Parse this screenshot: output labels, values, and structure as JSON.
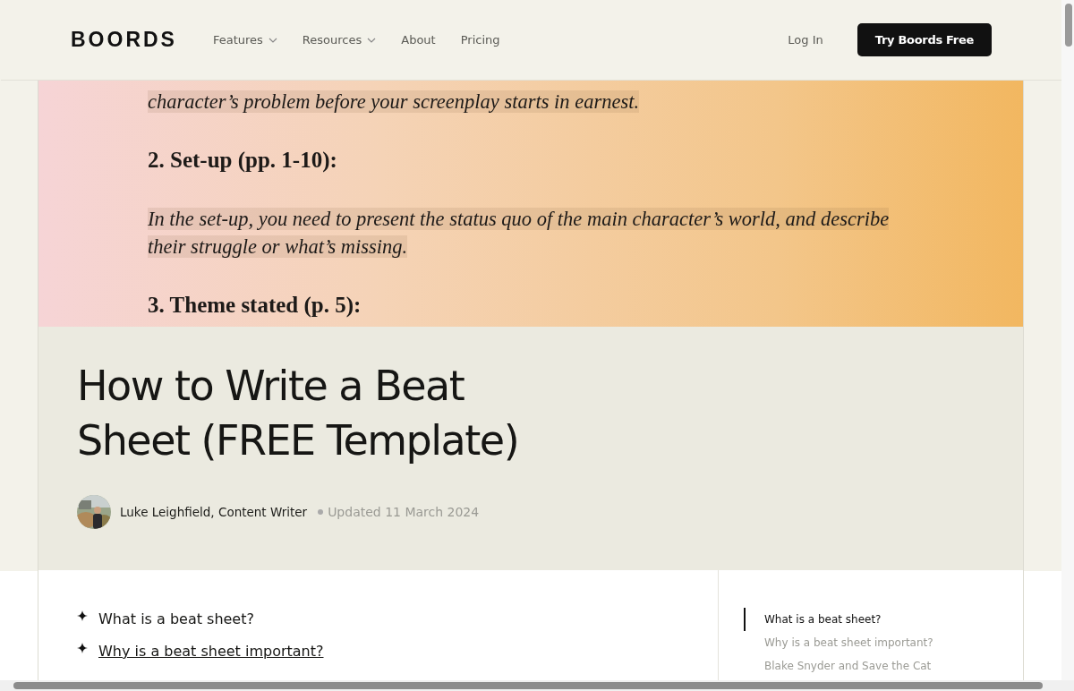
{
  "header": {
    "logo": "BOORDS",
    "nav": [
      {
        "label": "Features",
        "dropdown": true
      },
      {
        "label": "Resources",
        "dropdown": true
      },
      {
        "label": "About",
        "dropdown": false
      },
      {
        "label": "Pricing",
        "dropdown": false
      }
    ],
    "login": "Log In",
    "cta": "Try Boords Free"
  },
  "hero_document": {
    "lines": [
      {
        "kind": "quote",
        "text": "character’s problem before your screenplay starts in earnest."
      },
      {
        "kind": "heading",
        "text": "2. Set-up (pp. 1-10):"
      },
      {
        "kind": "quote",
        "text": "In the set-up, you need to present the status quo of the main character’s world, and describe their struggle or what’s missing."
      },
      {
        "kind": "heading",
        "text": "3. Theme stated (p. 5):"
      }
    ]
  },
  "article": {
    "title": "How to Write a Beat Sheet (FREE Template)",
    "author": "Luke Leighfield, Content Writer",
    "updated": "Updated 11 March 2024"
  },
  "contents": [
    {
      "label": "What is a beat sheet?",
      "hovered": false
    },
    {
      "label": "Why is a beat sheet important?",
      "hovered": true
    }
  ],
  "toc": [
    {
      "label": "What is a beat sheet?",
      "selected": true
    },
    {
      "label": "Why is a beat sheet important?",
      "selected": false
    },
    {
      "label": "Blake Snyder and Save the Cat",
      "selected": false
    }
  ]
}
